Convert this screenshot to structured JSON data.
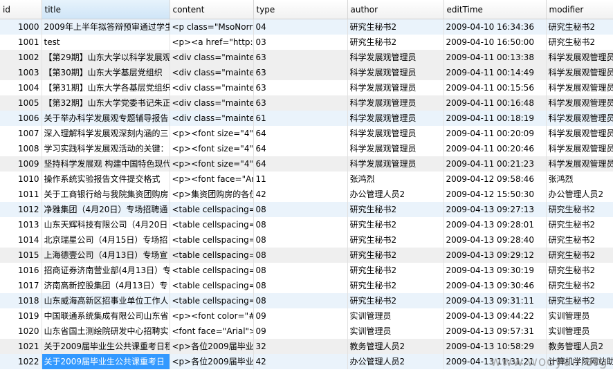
{
  "columns": [
    "id",
    "title",
    "content",
    "type",
    "author",
    "editTime",
    "modifier"
  ],
  "rows": [
    {
      "id": "1000",
      "title": "2009年上半年拟答辩预审通过学生",
      "content": "<p class=\"MsoNorr",
      "type": "04",
      "author": "研究生秘书2",
      "editTime": "2009-04-10 16:34:36",
      "modifier": "研究生秘书2"
    },
    {
      "id": "1001",
      "title": "test",
      "content": "<p><a href=\"http:/",
      "type": "03",
      "author": "研究生秘书2",
      "editTime": "2009-04-10 16:50:00",
      "modifier": "研究生秘书2"
    },
    {
      "id": "1002",
      "title": "【第29期】山东大学以科学发展观",
      "content": "<div class=\"maintex",
      "type": "63",
      "author": "科学发展观管理员",
      "editTime": "2009-04-11 00:13:38",
      "modifier": "科学发展观管理员"
    },
    {
      "id": "1003",
      "title": "【第30期】山东大学基层党组织",
      "content": "<div class=\"maintex",
      "type": "63",
      "author": "科学发展观管理员",
      "editTime": "2009-04-11 00:14:49",
      "modifier": "科学发展观管理员"
    },
    {
      "id": "1004",
      "title": "【第31期】山东大学各基层党组织",
      "content": "<div class=\"maintex",
      "type": "63",
      "author": "科学发展观管理员",
      "editTime": "2009-04-11 00:15:56",
      "modifier": "科学发展观管理员"
    },
    {
      "id": "1005",
      "title": "【第32期】山东大学党委书记朱正",
      "content": "<div class=\"maintex",
      "type": "63",
      "author": "科学发展观管理员",
      "editTime": "2009-04-11 00:16:48",
      "modifier": "科学发展观管理员"
    },
    {
      "id": "1006",
      "title": "关于举办科学发展观专题辅导报告",
      "content": "<div class=\"maintex",
      "type": "61",
      "author": "科学发展观管理员",
      "editTime": "2009-04-11 00:18:19",
      "modifier": "科学发展观管理员"
    },
    {
      "id": "1007",
      "title": "深入理解科学发展观深刻内涵的三",
      "content": "<p><font size=\"4\">",
      "type": "64",
      "author": "科学发展观管理员",
      "editTime": "2009-04-11 00:20:09",
      "modifier": "科学发展观管理员"
    },
    {
      "id": "1008",
      "title": "学习实践科学发展观活动的关键：",
      "content": "<p><font size=\"4\">",
      "type": "64",
      "author": "科学发展观管理员",
      "editTime": "2009-04-11 00:20:46",
      "modifier": "科学发展观管理员"
    },
    {
      "id": "1009",
      "title": "坚持科学发展观 构建中国特色现代",
      "content": "<p><font size=\"4\">",
      "type": "64",
      "author": "科学发展观管理员",
      "editTime": "2009-04-11 00:21:23",
      "modifier": "科学发展观管理员"
    },
    {
      "id": "1010",
      "title": "操作系统实验报告文件提交格式",
      "content": "<p><font face=\"Ari",
      "type": "11",
      "author": "张鸿烈",
      "editTime": "2009-04-12 09:58:46",
      "modifier": "张鸿烈"
    },
    {
      "id": "1011",
      "title": "关于工商银行给与我院集资团购房",
      "content": "<p>集资团购房的各位",
      "type": "42",
      "author": "办公管理人员2",
      "editTime": "2009-04-12 15:50:30",
      "modifier": "办公管理人员2"
    },
    {
      "id": "1012",
      "title": "净雅集团（4月20日）专场招聘通",
      "content": "<table cellspacing=",
      "type": "08",
      "author": "研究生秘书2",
      "editTime": "2009-04-13 09:27:13",
      "modifier": "研究生秘书2"
    },
    {
      "id": "1013",
      "title": "山东天辉科技有限公司（4月20日",
      "content": "<table cellspacing=",
      "type": "08",
      "author": "研究生秘书2",
      "editTime": "2009-04-13 09:28:01",
      "modifier": "研究生秘书2"
    },
    {
      "id": "1014",
      "title": "北京瑞星公司（4月15日）专场招",
      "content": "<table cellspacing=",
      "type": "08",
      "author": "研究生秘书2",
      "editTime": "2009-04-13 09:28:40",
      "modifier": "研究生秘书2"
    },
    {
      "id": "1015",
      "title": "上海德壹公司（4月13日）专场宣",
      "content": "<table cellspacing=",
      "type": "08",
      "author": "研究生秘书2",
      "editTime": "2009-04-13 09:29:12",
      "modifier": "研究生秘书2"
    },
    {
      "id": "1016",
      "title": "招商证券济南营业部(4月13日）专",
      "content": "<table cellspacing=",
      "type": "08",
      "author": "研究生秘书2",
      "editTime": "2009-04-13 09:30:19",
      "modifier": "研究生秘书2"
    },
    {
      "id": "1017",
      "title": "济南高新控股集团（4月13日）专",
      "content": "<table cellspacing=",
      "type": "08",
      "author": "研究生秘书2",
      "editTime": "2009-04-13 09:30:46",
      "modifier": "研究生秘书2"
    },
    {
      "id": "1018",
      "title": "山东威海高新区招事业单位工作人",
      "content": "<table cellspacing=",
      "type": "08",
      "author": "研究生秘书2",
      "editTime": "2009-04-13 09:31:11",
      "modifier": "研究生秘书2"
    },
    {
      "id": "1019",
      "title": "中国联通系统集成有限公司山东省",
      "content": "<p><font color=\"#(",
      "type": "09",
      "author": "实训管理员",
      "editTime": "2009-04-13 09:44:22",
      "modifier": "实训管理员"
    },
    {
      "id": "1020",
      "title": "山东省国土测绘院研发中心招聘实",
      "content": "<font face=\"Arial\">",
      "type": "09",
      "author": "实训管理员",
      "editTime": "2009-04-13 09:57:31",
      "modifier": "实训管理员"
    },
    {
      "id": "1021",
      "title": "关于2009届毕业生公共课重考日程",
      "content": "<p>各位2009届毕业",
      "type": "32",
      "author": "教务管理人员2",
      "editTime": "2009-04-13 10:58:29",
      "modifier": "教务管理人员2"
    },
    {
      "id": "1022",
      "title": "关于2009届毕业生公共课重考日",
      "content": "<p>各位2009届毕业",
      "type": "42",
      "author": "办公管理人员2",
      "editTime": "2009-04-13 11:31:21",
      "modifier": "计算机学院网站助"
    }
  ],
  "watermark": "www.wooyun.org"
}
